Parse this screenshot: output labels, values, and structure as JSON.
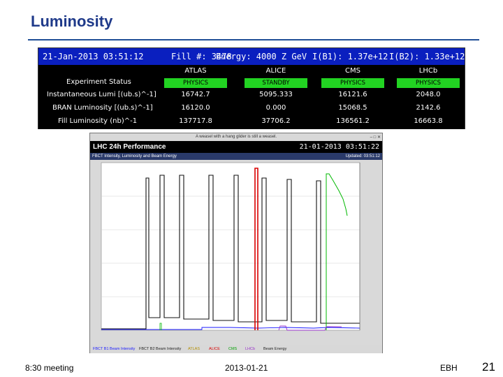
{
  "slide": {
    "title": "Luminosity",
    "footer_left": "8:30 meeting",
    "footer_center": "2013-01-21",
    "footer_right": "EBH",
    "page_number": "21"
  },
  "status": {
    "timestamp": "21-Jan-2013 03:51:12",
    "fill": "Fill #: 3478",
    "energy": "Energy: 4000 Z GeV",
    "ib1": "I(B1): 1.37e+12",
    "ib2": "I(B2): 1.33e+12",
    "columns": [
      "ATLAS",
      "ALICE",
      "CMS",
      "LHCb"
    ],
    "rows": [
      {
        "label": "Experiment Status",
        "values": [
          "PHYSICS",
          "STANDBY",
          "PHYSICS",
          "PHYSICS"
        ]
      },
      {
        "label": "Instantaneous Lumi [(ub.s)^-1]",
        "values": [
          "16742.7",
          "5095.333",
          "16121.6",
          "2048.0"
        ]
      },
      {
        "label": "BRAN Luminosity [(ub.s)^-1]",
        "values": [
          "16120.0",
          "0.000",
          "15068.5",
          "2142.6"
        ]
      },
      {
        "label": "Fill Luminosity (nb)^-1",
        "values": [
          "137717.8",
          "37706.2",
          "136561.2",
          "16663.8"
        ]
      }
    ]
  },
  "performance": {
    "window_caption": "A weasel with a hang glider is still a weasel.",
    "title": "LHC 24h Performance",
    "datetime": "21-01-2013 03:51:22",
    "subtitle": "FBCT Intensity, Luminosity and Beam Energy",
    "updated": "Updated: 03:51:12",
    "legend": [
      "FBCT B1 Beam Intensity",
      "FBCT B2 Beam Intensity",
      "ATLAS",
      "ALICE",
      "CMS",
      "LHCb",
      "Beam Energy"
    ],
    "colors": {
      "beam1": "#1a1aff",
      "beam2": "#111111",
      "atlas": "#d9b300",
      "alice": "#d80000",
      "cms": "#00b800",
      "lhcb": "#9933cc",
      "energy": "#000000"
    }
  }
}
